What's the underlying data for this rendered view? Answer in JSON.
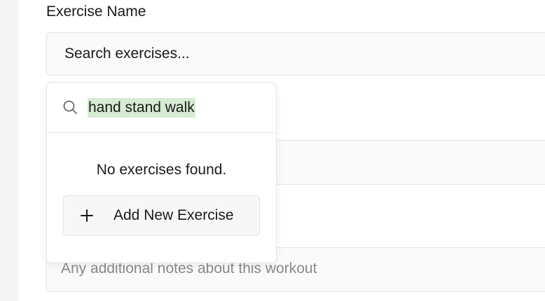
{
  "form": {
    "exercise_label": "Exercise Name",
    "search_placeholder": "Search exercises...",
    "notes_placeholder": "Any additional notes about this workout"
  },
  "dropdown": {
    "search_value": "hand stand walk",
    "empty_message": "No exercises found.",
    "add_button_label": "Add New Exercise"
  },
  "icons": {
    "search": "search-icon",
    "add": "plus-icon"
  },
  "colors": {
    "highlight": "#d6ecd2",
    "field_bg": "#fafafa",
    "border": "#e5e5e5"
  }
}
